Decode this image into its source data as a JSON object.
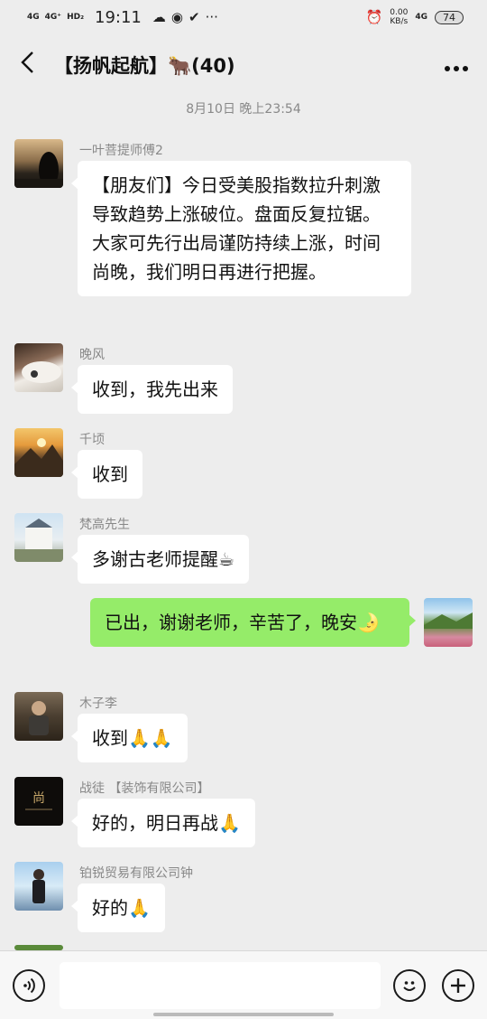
{
  "status_bar": {
    "signal_1": "4G",
    "signal_2": "4G⁺",
    "hd": "HD₂",
    "time": "19:11",
    "net_speed": "0.00",
    "net_unit": "KB/s",
    "net_type": "4G",
    "battery": "74"
  },
  "header": {
    "title": "【扬帆起航】🐂(40)"
  },
  "timestamp": "8月10日 晚上23:54",
  "messages": [
    {
      "sender": "一叶菩提师傅2",
      "text": "【朋友们】今日受美股指数拉升刺激导致趋势上涨破位。盘面反复拉锯。大家可先行出局谨防持续上涨，时间尚晚，我们明日再进行把握。"
    },
    {
      "sender": "晚风",
      "text": "收到，我先出来"
    },
    {
      "sender": "千顷",
      "text": "收到"
    },
    {
      "sender": "梵高先生",
      "text": "多谢古老师提醒☕"
    },
    {
      "sender": "",
      "text": "已出，谢谢老师，辛苦了，晚安🌛"
    },
    {
      "sender": "木子李",
      "text": "收到🙏🙏"
    },
    {
      "sender": "战徒  【装饰有限公司】",
      "text": "好的，明日再战🙏"
    },
    {
      "sender": "铂锐贸易有限公司钟",
      "text": "好的🙏"
    }
  ],
  "icons": {
    "back": "chevron-left-icon",
    "more": "more-dots-icon",
    "voice": "voice-icon",
    "emoji": "emoji-icon",
    "add": "plus-icon"
  },
  "colors": {
    "self_bubble": "#95ec69",
    "other_bubble": "#ffffff",
    "background": "#ededed"
  }
}
